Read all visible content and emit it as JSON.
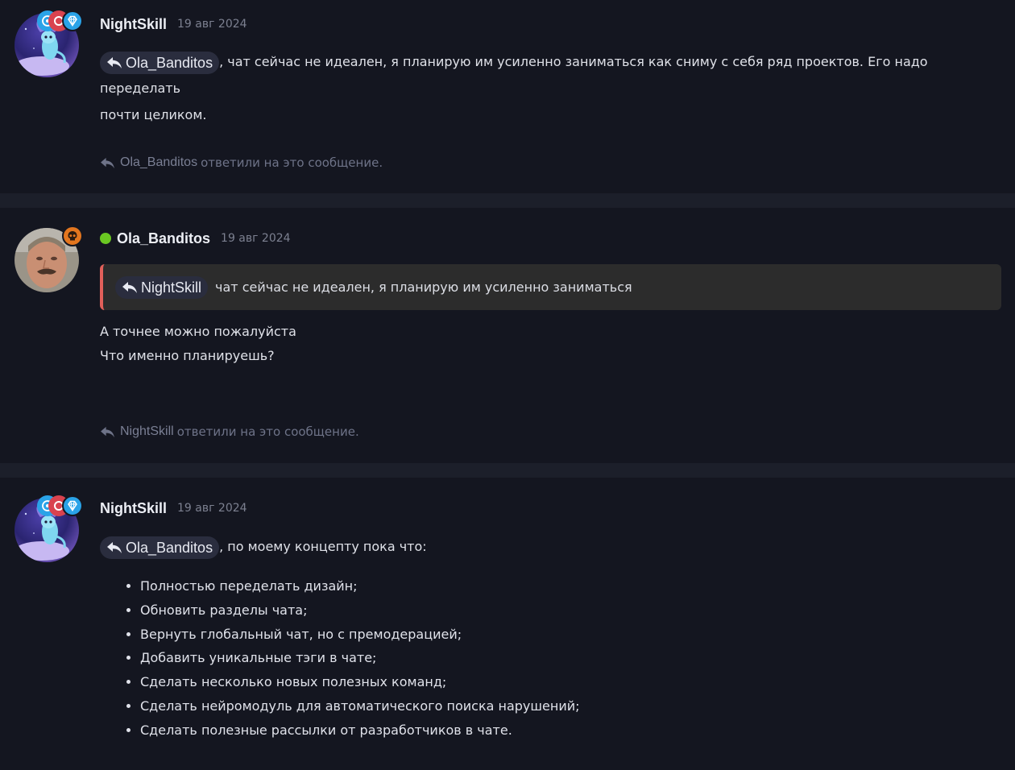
{
  "posts": [
    {
      "username": "NightSkill",
      "date": "19 авг 2024",
      "mention": "Ola_Banditos",
      "text_line1": ", чат сейчас не идеален, я планирую им усиленно заниматься как сниму с себя ряд проектов. Его надо переделать",
      "text_line2": "почти целиком.",
      "replied_user": "Ola_Banditos",
      "replied_suffix": "ответили на это сообщение."
    },
    {
      "username": "Ola_Banditos",
      "date": "19 авг 2024",
      "quote_user": "NightSkill",
      "quote_text": "чат сейчас не идеален, я планирую им усиленно заниматься",
      "text_line1": "А точнее можно пожалуйста",
      "text_line2": "Что именно планируешь?",
      "replied_user": "NightSkill",
      "replied_suffix": "ответили на это сообщение."
    },
    {
      "username": "NightSkill",
      "date": "19 авг 2024",
      "mention": "Ola_Banditos",
      "text_line1": ", по моему концепту пока что:",
      "items": [
        "Полностью переделать дизайн;",
        "Обновить разделы чата;",
        "Вернуть глобальный чат, но с премодерацией;",
        "Добавить уникальные тэги в чате;",
        "Сделать несколько новых полезных команд;",
        "Сделать нейромодуль для автоматического поиска нарушений;",
        "Сделать полезные рассылки от разработчиков в чате."
      ]
    }
  ],
  "colors": {
    "background": "#141620",
    "separator": "#1c1f2a",
    "online": "#6ac722",
    "quote_accent": "#e2605a",
    "badge_blue": "#2aa3e8",
    "badge_red": "#d9434f",
    "badge_orange": "#e3761f"
  },
  "icons": [
    "reply-icon",
    "gem-badge-icon",
    "skull-badge-icon",
    "online-status-icon"
  ]
}
